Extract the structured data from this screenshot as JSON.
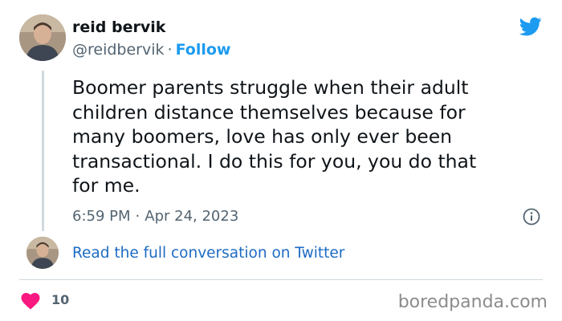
{
  "author": {
    "name": "reid bervik",
    "handle": "@reidbervik",
    "separator": "·",
    "follow_label": "Follow"
  },
  "tweet": {
    "text": "Boomer parents struggle when their adult\nchildren distance themselves because for\nmany boomers, love has only ever been\ntransactional. I do this for you, you do that\nfor me.",
    "time": "6:59 PM",
    "separator": "·",
    "date": "Apr 24, 2023"
  },
  "conversation_link": "Read the full conversation on Twitter",
  "likes": {
    "count": "10"
  },
  "watermark": "boredpanda.com",
  "colors": {
    "twitter_blue": "#1d9bf0",
    "link_blue": "#1d6bc4",
    "heart": "#f91880",
    "muted_text": "#536471"
  },
  "icons": {
    "brand": "twitter-bird-icon",
    "info": "info-icon",
    "like": "heart-icon"
  }
}
